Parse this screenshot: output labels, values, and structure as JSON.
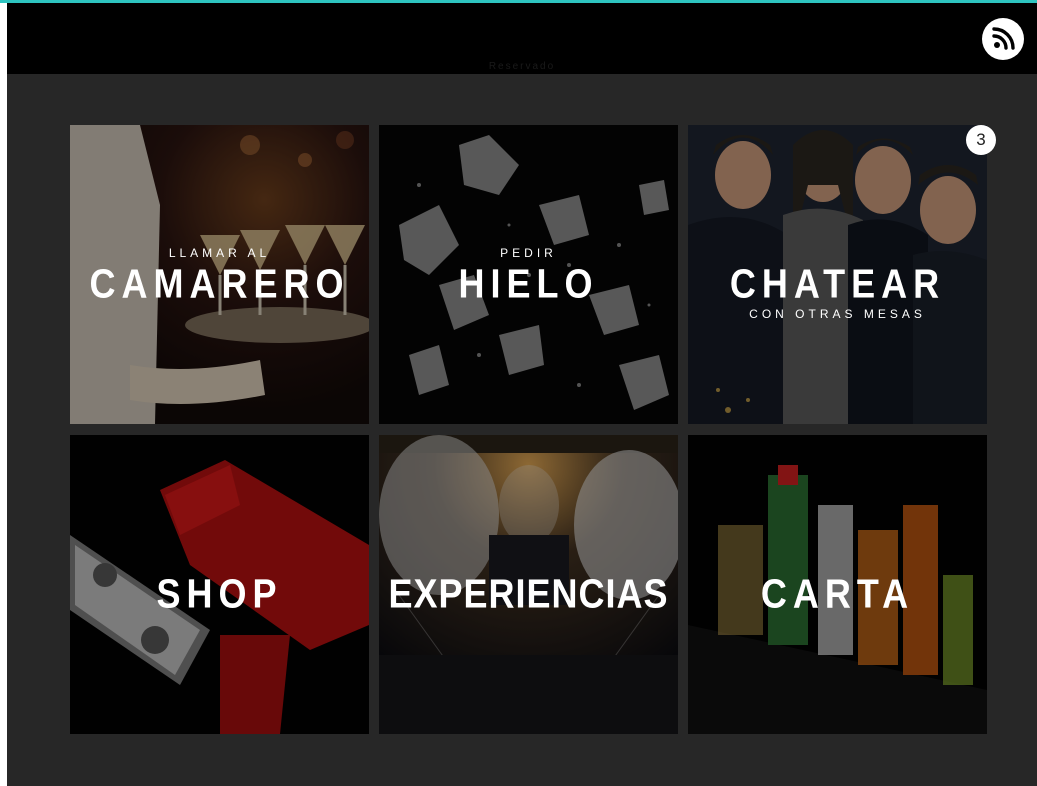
{
  "header": {
    "title": "Reservado",
    "feed_icon": "rss-feed-icon"
  },
  "colors": {
    "accent": "#2ec4c0",
    "background": "#272727",
    "header": "#000000"
  },
  "tiles": [
    {
      "small": "LLAMAR AL",
      "big": "CAMARERO",
      "icon": "waiter-tray-photo"
    },
    {
      "small": "PEDIR",
      "big": "HIELO",
      "icon": "ice-cubes-photo"
    },
    {
      "small": "CON OTRAS MESAS",
      "big": "CHATEAR",
      "badge": "3",
      "icon": "party-people-photo"
    },
    {
      "big": "SHOP",
      "icon": "money-gun-photo"
    },
    {
      "big": "EXPERIENCIAS",
      "icon": "club-stage-photo"
    },
    {
      "big": "CARTA",
      "icon": "bottles-photo"
    }
  ]
}
